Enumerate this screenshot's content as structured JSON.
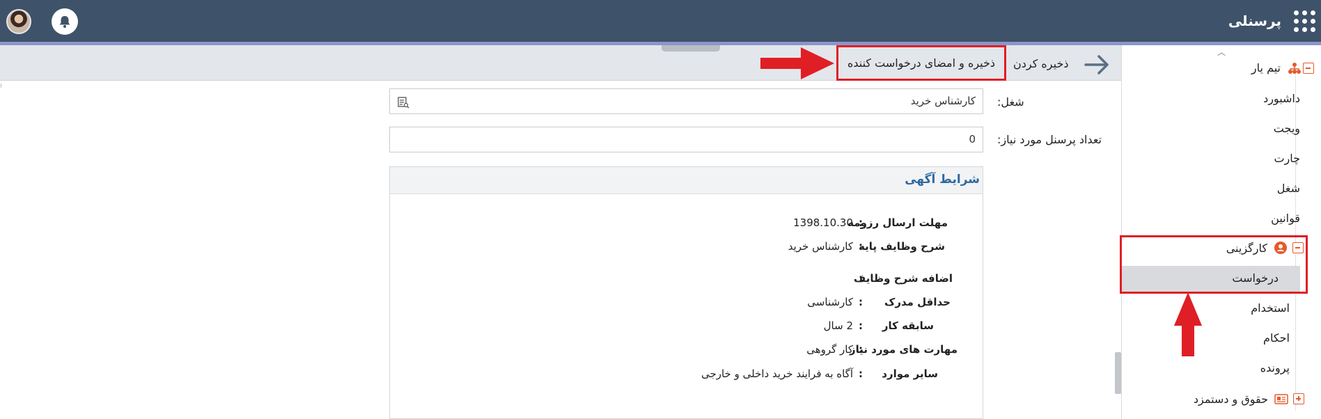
{
  "header": {
    "app_title": "پرسنلی"
  },
  "toolbar": {
    "save_label": "ذخیره کردن",
    "save_sign_label": "ذخیره و امضای درخواست کننده"
  },
  "sidebar": {
    "team": {
      "label": "تیم یار",
      "items": [
        "داشبورد",
        "ویجت",
        "چارت",
        "شغل",
        "قوانین"
      ]
    },
    "hr": {
      "label": "کارگزینی",
      "items": [
        "درخواست",
        "استخدام",
        "احکام",
        "پرونده"
      ]
    },
    "payroll": {
      "label": "حقوق و دستمزد"
    }
  },
  "form": {
    "job_label": "شغل:",
    "job_value": "کارشناس خرید",
    "count_label": "تعداد پرسنل مورد نیاز:",
    "count_value": "0"
  },
  "ad_panel": {
    "title": "شرایط آگهی",
    "rows": [
      {
        "key": "مهلت ارسال رزومه",
        "value": "1398.10.30"
      },
      {
        "key": "شرح وظایف پایه",
        "value": "کارشناس خرید"
      },
      {
        "key": "اضافه شرح وظایف",
        "value": ""
      },
      {
        "key": "حداقل مدرک",
        "value": "کارشناسی"
      },
      {
        "key": "سابقه کار",
        "value": "2 سال"
      },
      {
        "key": "مهارت های مورد نیاز",
        "value": "کار گروهی"
      },
      {
        "key": "سایر موارد",
        "value": "آگاه به فرایند خرید داخلی و خارجی"
      }
    ]
  },
  "colors": {
    "topbar": "#3e5269",
    "accent_red": "#e01e26",
    "accent_orange": "#e55a2b",
    "title_blue": "#2f6aa0"
  },
  "icons": {
    "apps": "grid-icon",
    "notifications": "bell-icon",
    "back": "arrow-right-icon",
    "job_lookup": "lookup-icon",
    "team": "org-chart-icon",
    "hr": "person-icon",
    "payroll": "id-card-icon"
  }
}
